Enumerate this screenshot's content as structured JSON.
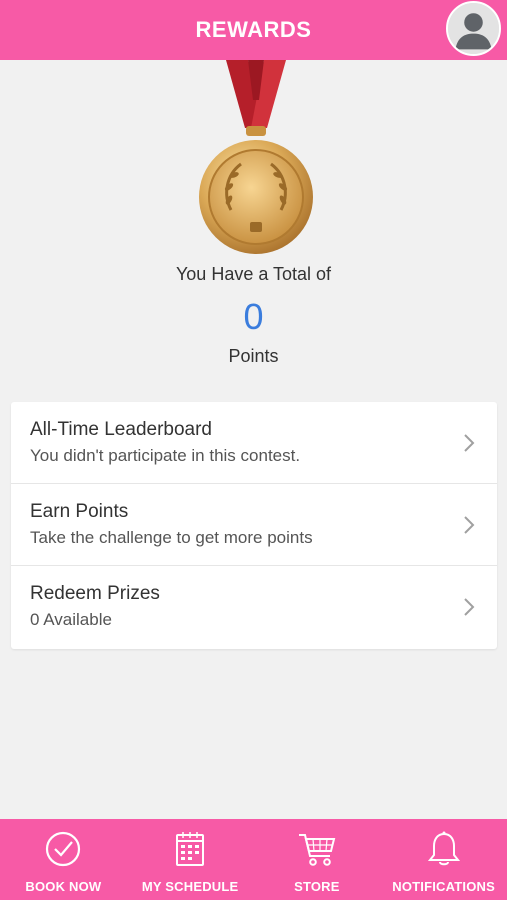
{
  "header": {
    "title": "REWARDS",
    "avatar_icon": "user-avatar-icon"
  },
  "summary": {
    "total_label": "You Have a Total of",
    "points": "0",
    "points_label": "Points"
  },
  "menu": [
    {
      "title": "All-Time Leaderboard",
      "subtitle": "You didn't participate in this contest."
    },
    {
      "title": "Earn Points",
      "subtitle": "Take the challenge to get more points"
    },
    {
      "title": "Redeem Prizes",
      "subtitle": "0 Available"
    }
  ],
  "tabs": [
    {
      "label": "BOOK NOW",
      "icon": "check-circle-icon"
    },
    {
      "label": "MY SCHEDULE",
      "icon": "calendar-icon"
    },
    {
      "label": "STORE",
      "icon": "cart-icon"
    },
    {
      "label": "NOTIFICATIONS",
      "icon": "bell-icon"
    }
  ],
  "colors": {
    "brand_pink": "#f75aa6",
    "points_blue": "#3b7ddd",
    "background": "#f1f1f1",
    "ribbon_red": "#c1222e",
    "medal_gold": "#d4a04a"
  }
}
